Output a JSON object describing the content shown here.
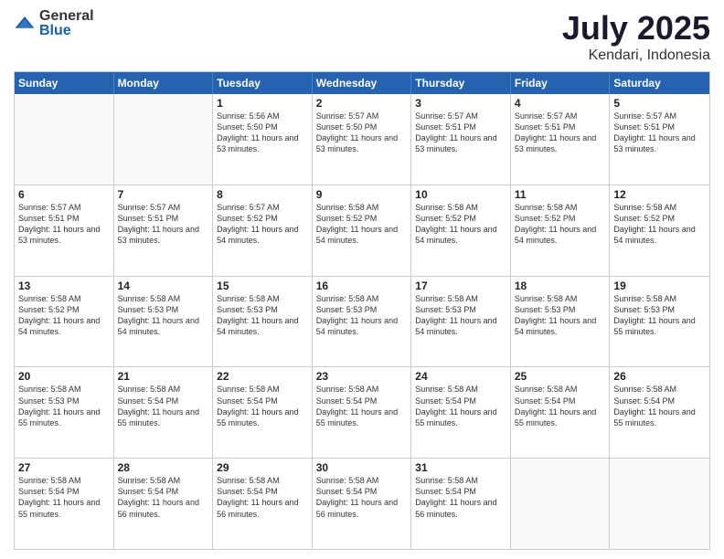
{
  "logo": {
    "general": "General",
    "blue": "Blue"
  },
  "title": {
    "month_year": "July 2025",
    "location": "Kendari, Indonesia"
  },
  "header_days": [
    "Sunday",
    "Monday",
    "Tuesday",
    "Wednesday",
    "Thursday",
    "Friday",
    "Saturday"
  ],
  "weeks": [
    [
      {
        "day": "",
        "sunrise": "",
        "sunset": "",
        "daylight": ""
      },
      {
        "day": "",
        "sunrise": "",
        "sunset": "",
        "daylight": ""
      },
      {
        "day": "1",
        "sunrise": "Sunrise: 5:56 AM",
        "sunset": "Sunset: 5:50 PM",
        "daylight": "Daylight: 11 hours and 53 minutes."
      },
      {
        "day": "2",
        "sunrise": "Sunrise: 5:57 AM",
        "sunset": "Sunset: 5:50 PM",
        "daylight": "Daylight: 11 hours and 53 minutes."
      },
      {
        "day": "3",
        "sunrise": "Sunrise: 5:57 AM",
        "sunset": "Sunset: 5:51 PM",
        "daylight": "Daylight: 11 hours and 53 minutes."
      },
      {
        "day": "4",
        "sunrise": "Sunrise: 5:57 AM",
        "sunset": "Sunset: 5:51 PM",
        "daylight": "Daylight: 11 hours and 53 minutes."
      },
      {
        "day": "5",
        "sunrise": "Sunrise: 5:57 AM",
        "sunset": "Sunset: 5:51 PM",
        "daylight": "Daylight: 11 hours and 53 minutes."
      }
    ],
    [
      {
        "day": "6",
        "sunrise": "Sunrise: 5:57 AM",
        "sunset": "Sunset: 5:51 PM",
        "daylight": "Daylight: 11 hours and 53 minutes."
      },
      {
        "day": "7",
        "sunrise": "Sunrise: 5:57 AM",
        "sunset": "Sunset: 5:51 PM",
        "daylight": "Daylight: 11 hours and 53 minutes."
      },
      {
        "day": "8",
        "sunrise": "Sunrise: 5:57 AM",
        "sunset": "Sunset: 5:52 PM",
        "daylight": "Daylight: 11 hours and 54 minutes."
      },
      {
        "day": "9",
        "sunrise": "Sunrise: 5:58 AM",
        "sunset": "Sunset: 5:52 PM",
        "daylight": "Daylight: 11 hours and 54 minutes."
      },
      {
        "day": "10",
        "sunrise": "Sunrise: 5:58 AM",
        "sunset": "Sunset: 5:52 PM",
        "daylight": "Daylight: 11 hours and 54 minutes."
      },
      {
        "day": "11",
        "sunrise": "Sunrise: 5:58 AM",
        "sunset": "Sunset: 5:52 PM",
        "daylight": "Daylight: 11 hours and 54 minutes."
      },
      {
        "day": "12",
        "sunrise": "Sunrise: 5:58 AM",
        "sunset": "Sunset: 5:52 PM",
        "daylight": "Daylight: 11 hours and 54 minutes."
      }
    ],
    [
      {
        "day": "13",
        "sunrise": "Sunrise: 5:58 AM",
        "sunset": "Sunset: 5:52 PM",
        "daylight": "Daylight: 11 hours and 54 minutes."
      },
      {
        "day": "14",
        "sunrise": "Sunrise: 5:58 AM",
        "sunset": "Sunset: 5:53 PM",
        "daylight": "Daylight: 11 hours and 54 minutes."
      },
      {
        "day": "15",
        "sunrise": "Sunrise: 5:58 AM",
        "sunset": "Sunset: 5:53 PM",
        "daylight": "Daylight: 11 hours and 54 minutes."
      },
      {
        "day": "16",
        "sunrise": "Sunrise: 5:58 AM",
        "sunset": "Sunset: 5:53 PM",
        "daylight": "Daylight: 11 hours and 54 minutes."
      },
      {
        "day": "17",
        "sunrise": "Sunrise: 5:58 AM",
        "sunset": "Sunset: 5:53 PM",
        "daylight": "Daylight: 11 hours and 54 minutes."
      },
      {
        "day": "18",
        "sunrise": "Sunrise: 5:58 AM",
        "sunset": "Sunset: 5:53 PM",
        "daylight": "Daylight: 11 hours and 54 minutes."
      },
      {
        "day": "19",
        "sunrise": "Sunrise: 5:58 AM",
        "sunset": "Sunset: 5:53 PM",
        "daylight": "Daylight: 11 hours and 55 minutes."
      }
    ],
    [
      {
        "day": "20",
        "sunrise": "Sunrise: 5:58 AM",
        "sunset": "Sunset: 5:53 PM",
        "daylight": "Daylight: 11 hours and 55 minutes."
      },
      {
        "day": "21",
        "sunrise": "Sunrise: 5:58 AM",
        "sunset": "Sunset: 5:54 PM",
        "daylight": "Daylight: 11 hours and 55 minutes."
      },
      {
        "day": "22",
        "sunrise": "Sunrise: 5:58 AM",
        "sunset": "Sunset: 5:54 PM",
        "daylight": "Daylight: 11 hours and 55 minutes."
      },
      {
        "day": "23",
        "sunrise": "Sunrise: 5:58 AM",
        "sunset": "Sunset: 5:54 PM",
        "daylight": "Daylight: 11 hours and 55 minutes."
      },
      {
        "day": "24",
        "sunrise": "Sunrise: 5:58 AM",
        "sunset": "Sunset: 5:54 PM",
        "daylight": "Daylight: 11 hours and 55 minutes."
      },
      {
        "day": "25",
        "sunrise": "Sunrise: 5:58 AM",
        "sunset": "Sunset: 5:54 PM",
        "daylight": "Daylight: 11 hours and 55 minutes."
      },
      {
        "day": "26",
        "sunrise": "Sunrise: 5:58 AM",
        "sunset": "Sunset: 5:54 PM",
        "daylight": "Daylight: 11 hours and 55 minutes."
      }
    ],
    [
      {
        "day": "27",
        "sunrise": "Sunrise: 5:58 AM",
        "sunset": "Sunset: 5:54 PM",
        "daylight": "Daylight: 11 hours and 55 minutes."
      },
      {
        "day": "28",
        "sunrise": "Sunrise: 5:58 AM",
        "sunset": "Sunset: 5:54 PM",
        "daylight": "Daylight: 11 hours and 56 minutes."
      },
      {
        "day": "29",
        "sunrise": "Sunrise: 5:58 AM",
        "sunset": "Sunset: 5:54 PM",
        "daylight": "Daylight: 11 hours and 56 minutes."
      },
      {
        "day": "30",
        "sunrise": "Sunrise: 5:58 AM",
        "sunset": "Sunset: 5:54 PM",
        "daylight": "Daylight: 11 hours and 56 minutes."
      },
      {
        "day": "31",
        "sunrise": "Sunrise: 5:58 AM",
        "sunset": "Sunset: 5:54 PM",
        "daylight": "Daylight: 11 hours and 56 minutes."
      },
      {
        "day": "",
        "sunrise": "",
        "sunset": "",
        "daylight": ""
      },
      {
        "day": "",
        "sunrise": "",
        "sunset": "",
        "daylight": ""
      }
    ]
  ]
}
